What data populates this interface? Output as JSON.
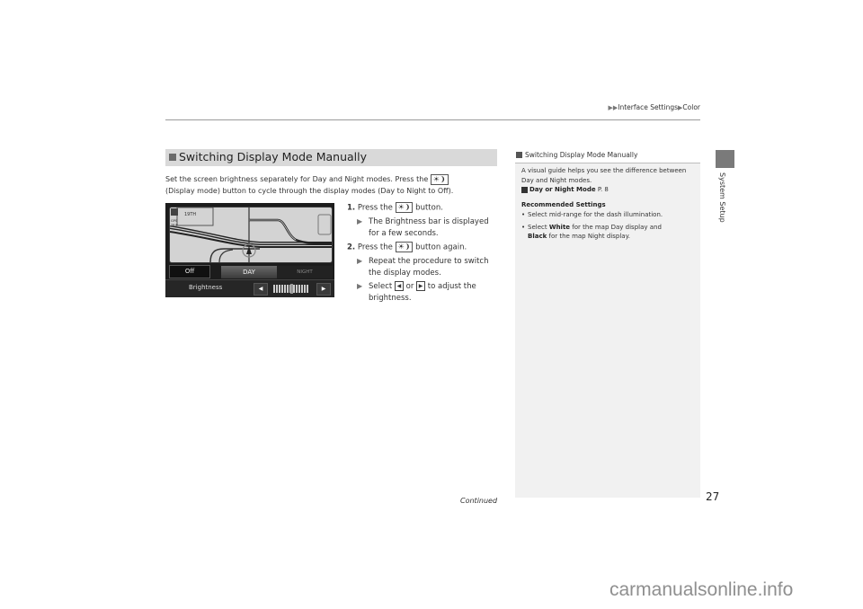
{
  "header": {
    "breadcrumb": [
      "Interface Settings",
      "Color"
    ]
  },
  "side_tab": {
    "label": "System Setup"
  },
  "section": {
    "title": "Switching Display Mode Manually",
    "intro_part1": "Set the screen brightness separately for Day and Night modes. Press the",
    "intro_part2": "(Display mode) button to cycle through the display modes (Day to Night to Off).",
    "button_glyph": "☀❩"
  },
  "screen": {
    "off_label": "Off",
    "day_label": "DAY",
    "night_label": "NIGHT",
    "brightness_label": "Brightness",
    "left_arrow": "◀",
    "right_arrow": "▶",
    "brightness_level": 0.5,
    "map_street_label": "19TH",
    "map_side_labels": [
      "GPS",
      "TRIP"
    ]
  },
  "steps": [
    {
      "num": "1.",
      "text_before": "Press the",
      "text_after": "button.",
      "subs": [
        "The Brightness bar is displayed for a few seconds."
      ]
    },
    {
      "num": "2.",
      "text_before": "Press the",
      "text_after": "button again.",
      "subs": [
        "Repeat the procedure to switch the display modes."
      ],
      "select_sub": {
        "before": "Select",
        "or": "or",
        "after": "to adjust the brightness."
      }
    }
  ],
  "note": {
    "title": "Switching Display Mode Manually",
    "text": "A visual guide helps you see the difference between Day and Night modes.",
    "xref_label": "Day or Night Mode",
    "xref_page": "P. 8",
    "rec_heading": "Recommended Settings",
    "bullet1": "Select mid-range for the dash illumination.",
    "bullet2_before": "Select",
    "bullet2_bold1": "White",
    "bullet2_mid": "for the map Day display and",
    "bullet2_bold2": "Black",
    "bullet2_after": "for the map Night display."
  },
  "footer": {
    "continued": "Continued",
    "page_number": "27",
    "watermark": "carmanualsonline.info"
  }
}
